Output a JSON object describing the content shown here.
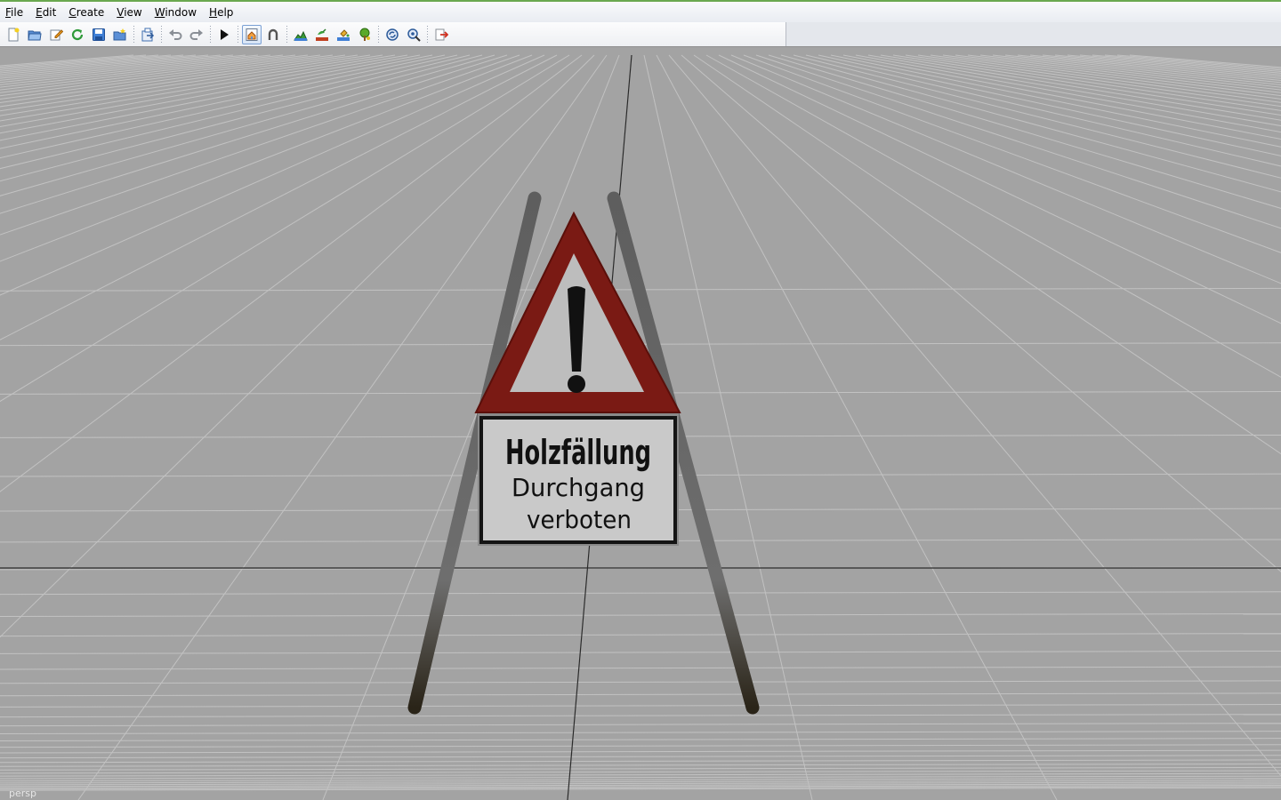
{
  "menubar": {
    "items": [
      "File",
      "Edit",
      "Create",
      "View",
      "Window",
      "Help"
    ]
  },
  "toolbar": {
    "buttons": [
      {
        "icon": "new-scene-icon"
      },
      {
        "icon": "open-scene-icon"
      },
      {
        "icon": "edit-icon"
      },
      {
        "icon": "refresh-icon"
      },
      {
        "icon": "save-icon"
      },
      {
        "icon": "save-as-icon"
      },
      {
        "icon": "export-icon"
      },
      {
        "icon": "undo-icon"
      },
      {
        "icon": "redo-icon"
      },
      {
        "icon": "play-icon"
      },
      {
        "icon": "home-view-icon",
        "active": true
      },
      {
        "icon": "magnet-icon"
      },
      {
        "icon": "terrain-icon"
      },
      {
        "icon": "plant-icon"
      },
      {
        "icon": "fill-icon"
      },
      {
        "icon": "tree-icon"
      },
      {
        "icon": "sync-icon"
      },
      {
        "icon": "settings-icon"
      },
      {
        "icon": "exit-icon"
      }
    ]
  },
  "viewport": {
    "camera_label": "persp",
    "sign": {
      "line1": "Holzfällung",
      "line2": "Durchgang",
      "line3": "verboten"
    }
  },
  "colors": {
    "viewport_bg": "#a3a3a3",
    "grid_line": "#c2c2c2",
    "sign_red": "#7a1a14",
    "accent_green": "#6aa84f"
  }
}
